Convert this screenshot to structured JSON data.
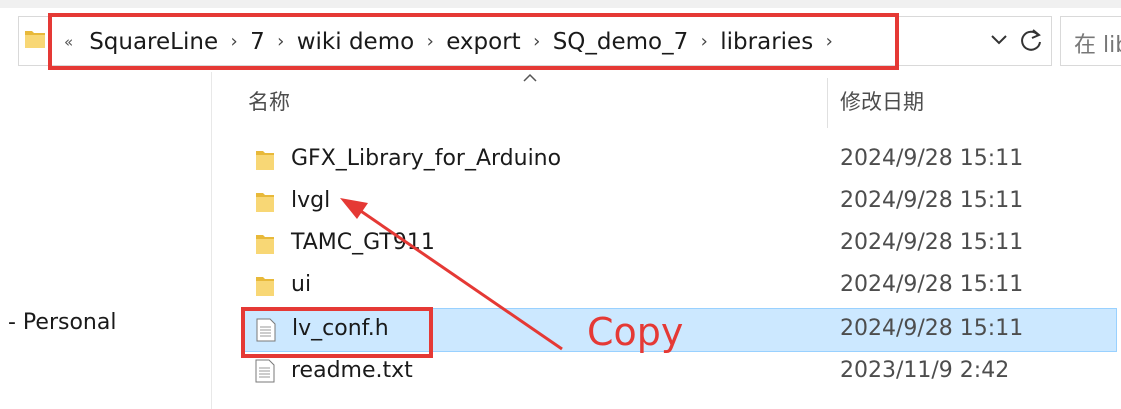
{
  "address_bar": {
    "overflow_glyph": "«",
    "breadcrumbs": [
      "SquareLine",
      "7",
      "wiki demo",
      "export",
      "SQ_demo_7",
      "libraries"
    ],
    "separator_glyph": "›",
    "search_placeholder": "在 lib"
  },
  "nav_pane": {
    "personal_label": "- Personal"
  },
  "columns": {
    "name": "名称",
    "date_modified": "修改日期"
  },
  "files": [
    {
      "name": "GFX_Library_for_Arduino",
      "date": "2024/9/28 15:11",
      "type": "folder",
      "selected": false
    },
    {
      "name": "lvgl",
      "date": "2024/9/28 15:11",
      "type": "folder",
      "selected": false
    },
    {
      "name": "TAMC_GT911",
      "date": "2024/9/28 15:11",
      "type": "folder",
      "selected": false
    },
    {
      "name": "ui",
      "date": "2024/9/28 15:11",
      "type": "folder",
      "selected": false
    },
    {
      "name": "lv_conf.h",
      "date": "2024/9/28 15:11",
      "type": "file",
      "selected": true
    },
    {
      "name": "readme.txt",
      "date": "2023/11/9 2:42",
      "type": "file",
      "selected": false
    }
  ],
  "annotation": {
    "label": "Copy",
    "color": "#e53935"
  },
  "colors": {
    "selection_bg": "#cce8ff",
    "selection_border": "#99d1ff",
    "folder_yellow": "#f8d775",
    "folder_dark": "#e8b93a"
  },
  "icons": {
    "folder": "folder-icon",
    "file": "file-icon"
  }
}
